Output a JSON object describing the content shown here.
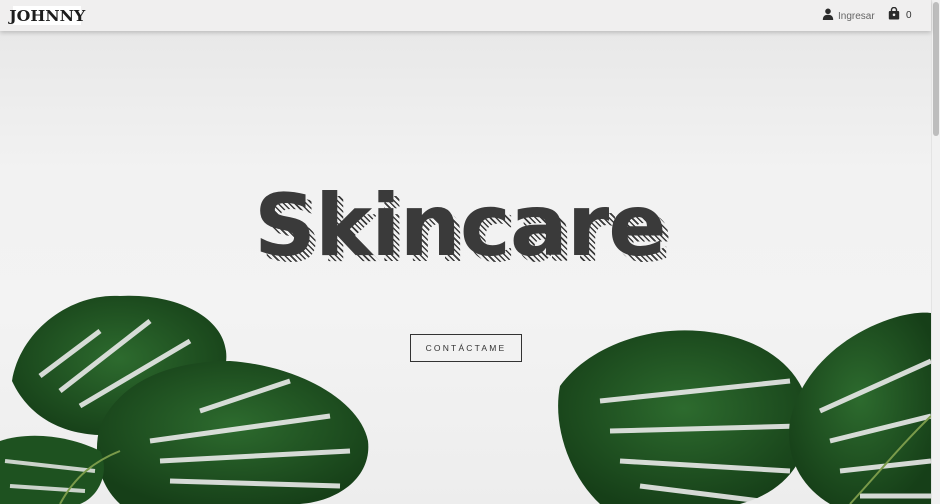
{
  "header": {
    "logo_text": "JOHNNY",
    "login_label": "Ingresar",
    "cart_count": "0"
  },
  "hero": {
    "title": "Skincare",
    "cta_label": "CONTÁCTAME"
  },
  "colors": {
    "header_bg": "#f0efef",
    "hero_bg": "#f2f2f2",
    "text_dark": "#3a3a3a",
    "leaf_green": "#1f5a22"
  },
  "icons": [
    "user-icon",
    "shopping-bag-icon"
  ]
}
